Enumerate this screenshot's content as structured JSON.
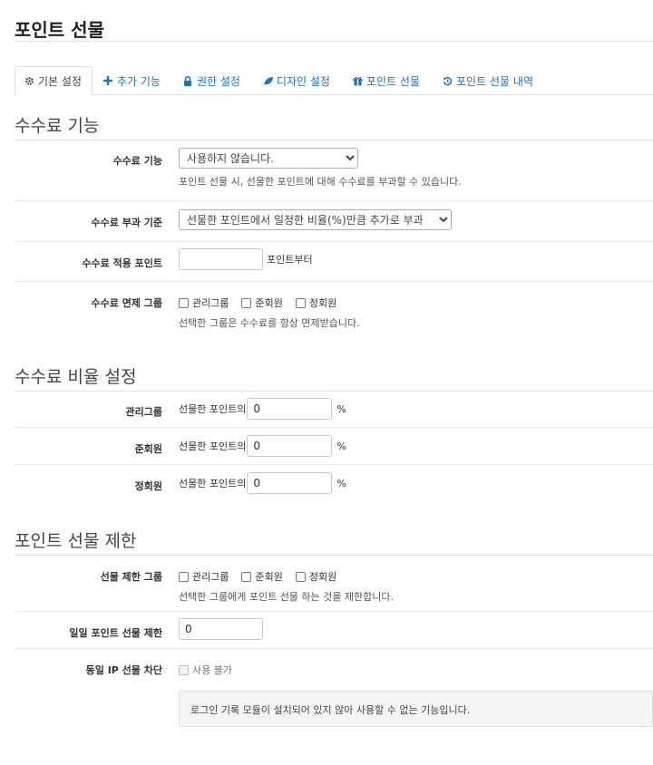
{
  "page_title": "포인트 선물",
  "tabs": [
    {
      "label": "기본 설정",
      "icon": "gear-icon",
      "active": true
    },
    {
      "label": "추가 기능",
      "icon": "plus-icon"
    },
    {
      "label": "권한 설정",
      "icon": "lock-icon"
    },
    {
      "label": "디자인 설정",
      "icon": "leaf-icon"
    },
    {
      "label": "포인트 선물",
      "icon": "gift-icon"
    },
    {
      "label": "포인트 선물 내역",
      "icon": "history-icon"
    }
  ],
  "fee_section": {
    "title": "수수료 기능",
    "fee_function": {
      "label": "수수료 기능",
      "selected": "사용하지 않습니다.",
      "help": "포인트 선물 시, 선물한 포인트에 대해 수수료를 부과할 수 있습니다."
    },
    "fee_basis": {
      "label": "수수료 부과 기준",
      "selected": "선물한 포인트에서 일정한 비율(%)만큼 추가로 부과"
    },
    "fee_min_point": {
      "label": "수수료 적용 포인트",
      "value": "",
      "suffix": "포인트부터"
    },
    "fee_exempt": {
      "label": "수수료 면제 그룹",
      "groups": [
        "관리그룹",
        "준회원",
        "정회원"
      ],
      "help": "선택한 그룹은 수수료를 항상 면제받습니다."
    }
  },
  "rate_section": {
    "title": "수수료 비율 설정",
    "rows": [
      {
        "label": "관리그룹",
        "prefix": "선물한 포인트의",
        "value": "0",
        "suffix": "%"
      },
      {
        "label": "준회원",
        "prefix": "선물한 포인트의",
        "value": "0",
        "suffix": "%"
      },
      {
        "label": "정회원",
        "prefix": "선물한 포인트의",
        "value": "0",
        "suffix": "%"
      }
    ]
  },
  "limit_section": {
    "title": "포인트 선물 제한",
    "limit_groups": {
      "label": "선물 제한 그룹",
      "groups": [
        "관리그룹",
        "준회원",
        "정회원"
      ],
      "help": "선택한 그룹에게 포인트 선물 하는 것을 제한합니다."
    },
    "daily_limit": {
      "label": "일일 포인트 선물 제한",
      "value": "0"
    },
    "same_ip": {
      "label": "동일 IP 선물 차단",
      "checkbox_label": "사용 불가",
      "notice": "로그인 기록 모듈이 설치되어 있지 않아 사용할 수 없는 기능입니다."
    }
  }
}
